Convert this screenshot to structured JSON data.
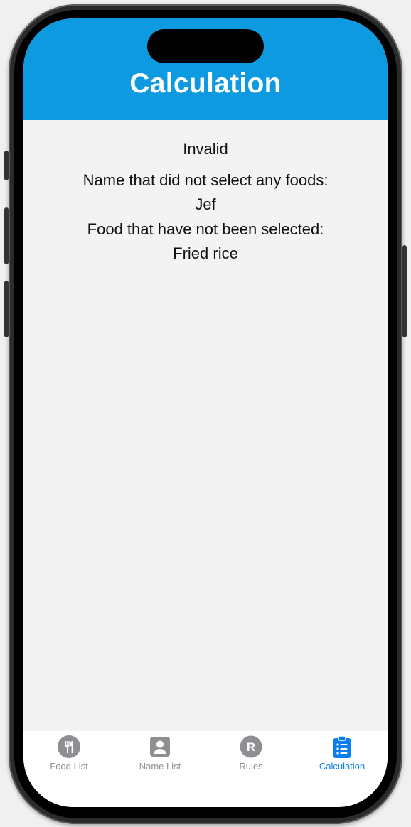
{
  "header": {
    "title": "Calculation"
  },
  "content": {
    "status": "Invalid",
    "no_food_label": "Name that did not select any foods:",
    "no_food_names": [
      "Jef"
    ],
    "unselected_label": "Food that have not been selected:",
    "unselected_foods": [
      "Fried rice"
    ]
  },
  "tabs": [
    {
      "label": "Food List",
      "icon": "fork-knife-icon",
      "active": false
    },
    {
      "label": "Name List",
      "icon": "person-card-icon",
      "active": false
    },
    {
      "label": "Rules",
      "icon": "r-circle-icon",
      "active": false
    },
    {
      "label": "Calculation",
      "icon": "clipboard-list-icon",
      "active": true
    }
  ],
  "colors": {
    "header": "#0d9ae0",
    "active_tab": "#0a7ef0",
    "inactive_tab": "#8e8e93"
  }
}
